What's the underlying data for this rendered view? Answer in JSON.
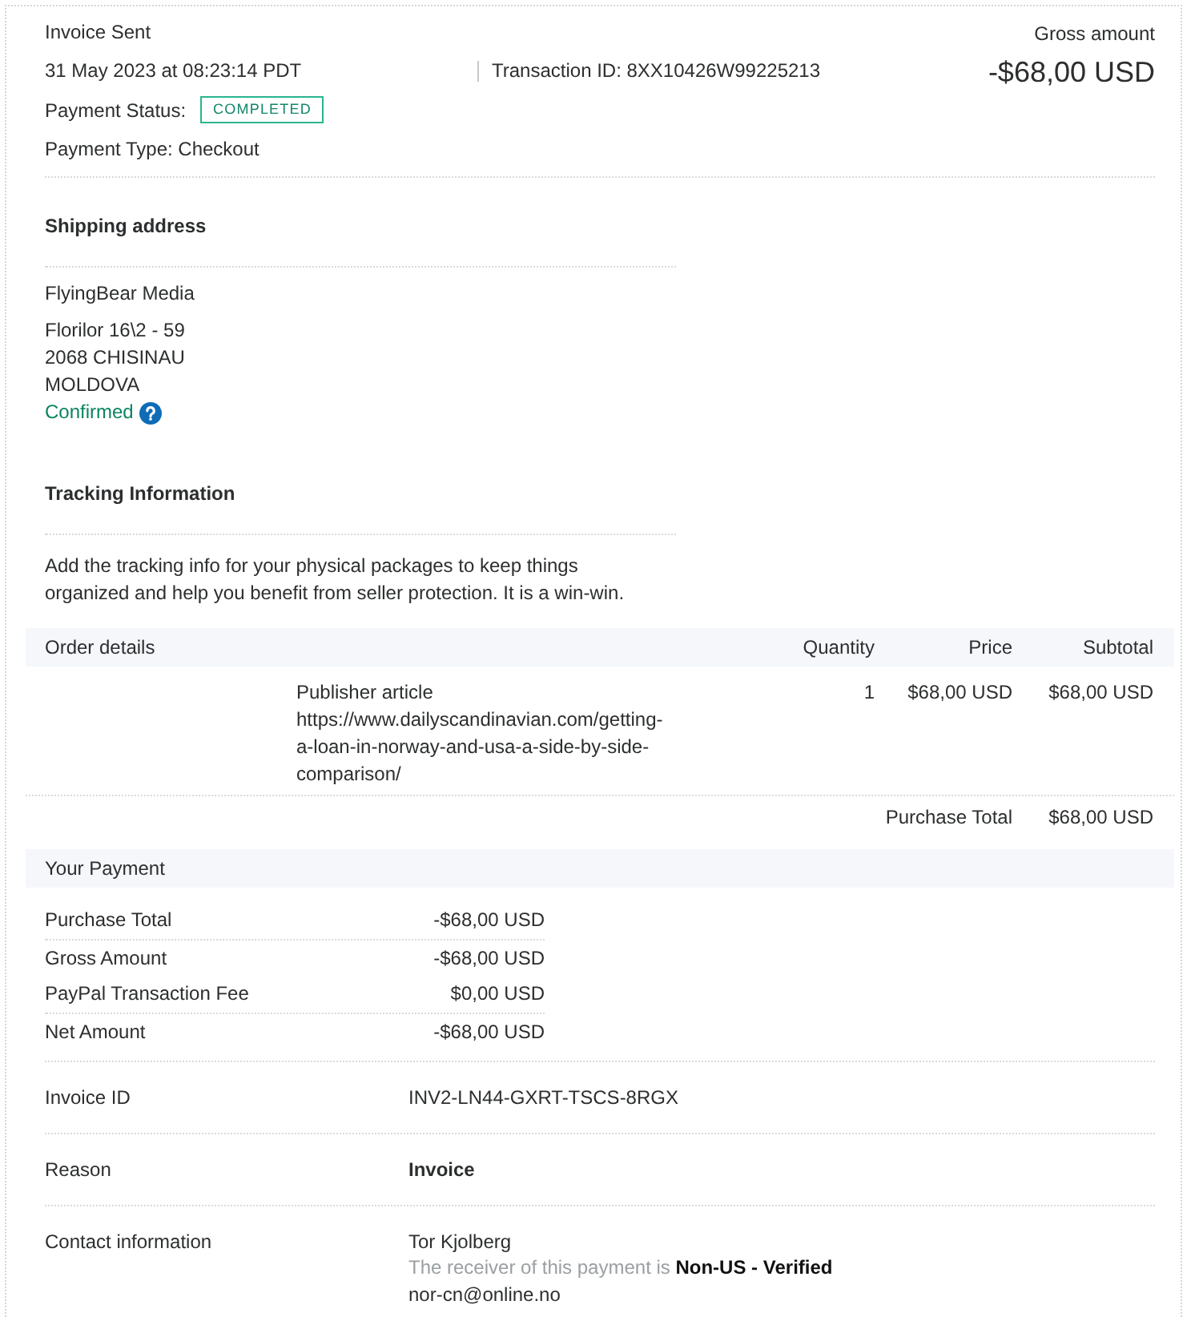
{
  "header": {
    "title": "Invoice Sent",
    "date": "31 May 2023 at 08:23:14 PDT",
    "transaction_id": "Transaction ID: 8XX10426W99225213",
    "payment_status_label": "Payment Status:",
    "payment_status": "COMPLETED",
    "payment_type": "Payment Type: Checkout",
    "gross_label": "Gross amount",
    "gross_amount": "-$68,00 USD"
  },
  "shipping": {
    "heading": "Shipping address",
    "name": "FlyingBear Media",
    "address_lines": [
      "Florilor 16\\2 - 59",
      "2068 CHISINAU",
      "MOLDOVA"
    ],
    "confirmation": "Confirmed"
  },
  "tracking": {
    "heading": "Tracking Information",
    "text": "Add the tracking info for your physical packages to keep things organized and help you benefit from seller protection. It is a win-win."
  },
  "order": {
    "columns": [
      "Order details",
      "Quantity",
      "Price",
      "Subtotal"
    ],
    "items": [
      {
        "name": "Publisher article",
        "description": "https://www.dailyscandinavian.com/getting-a-loan-in-norway-and-usa-a-side-by-side-comparison/",
        "quantity": "1",
        "price": "$68,00 USD",
        "subtotal": "$68,00 USD"
      }
    ],
    "total_label": "Purchase Total",
    "total": "$68,00 USD"
  },
  "payment": {
    "heading": "Your Payment",
    "groups": [
      [
        {
          "label": "Purchase Total",
          "value": "-$68,00 USD"
        }
      ],
      [
        {
          "label": "Gross Amount",
          "value": "-$68,00 USD"
        },
        {
          "label": "PayPal Transaction Fee",
          "value": "$0,00 USD"
        }
      ],
      [
        {
          "label": "Net Amount",
          "value": "-$68,00 USD"
        }
      ]
    ]
  },
  "details": [
    {
      "kind": "plain",
      "label": "Invoice ID",
      "value": "INV2-LN44-GXRT-TSCS-8RGX"
    },
    {
      "kind": "bold",
      "label": "Reason",
      "value": "Invoice"
    },
    {
      "kind": "contact",
      "label": "Contact information",
      "name": "Tor Kjolberg",
      "note": "The receiver of this payment is **Non-US - Verified**",
      "email": "nor-cn@online.no"
    }
  ]
}
